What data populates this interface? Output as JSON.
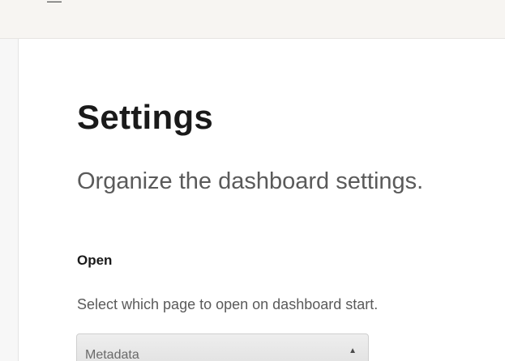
{
  "top_bar": {
    "glyph": "—"
  },
  "settings": {
    "title": "Settings",
    "subtitle": "Organize the dashboard settings."
  },
  "open_section": {
    "heading": "Open",
    "description": "Select which page to open on dashboard start.",
    "select": {
      "value": "Metadata",
      "arrow_icon": "chevron-up-icon",
      "arrow_glyph": "▲"
    }
  }
}
